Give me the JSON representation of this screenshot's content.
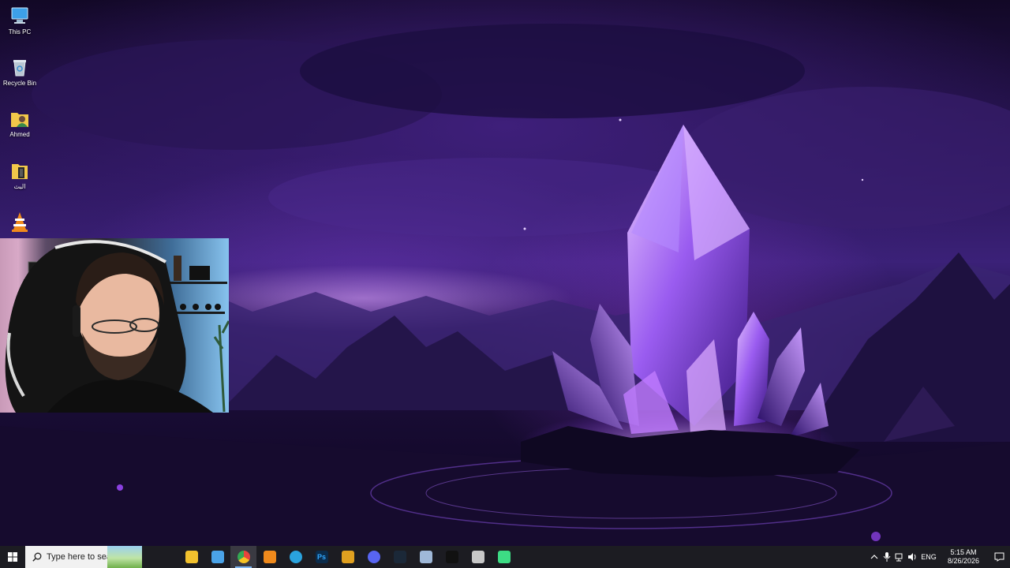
{
  "desktop": {
    "icons": [
      {
        "label": "This PC",
        "icon": "computer-icon"
      },
      {
        "label": "Recycle Bin",
        "icon": "recycle-bin-icon"
      },
      {
        "label": "Ahmed",
        "icon": "user-folder-icon"
      },
      {
        "label": "البث",
        "icon": "folder-icon"
      },
      {
        "label": "",
        "icon": "vlc-icon"
      }
    ]
  },
  "taskbar": {
    "search_placeholder": "Type here to search",
    "apps": [
      {
        "name": "file-explorer",
        "icon": "folder-icon",
        "color": "#f2c12e",
        "active": false
      },
      {
        "name": "store",
        "icon": "window-icon",
        "color": "#4aa3e8",
        "active": false
      },
      {
        "name": "chrome",
        "icon": "chrome-icon",
        "color": "#e8453c",
        "active": true
      },
      {
        "name": "vlc",
        "icon": "vlc-icon",
        "color": "#f08a1c",
        "active": false
      },
      {
        "name": "telegram",
        "icon": "telegram-icon",
        "color": "#2aa3de",
        "active": false
      },
      {
        "name": "photoshop",
        "icon": "photoshop-icon",
        "color": "#0b2b4a",
        "active": false,
        "glyph": "Ps"
      },
      {
        "name": "shield-app",
        "icon": "shield-icon",
        "color": "#e0a020",
        "active": false
      },
      {
        "name": "discord-app",
        "icon": "discord-icon",
        "color": "#5865f2",
        "active": false
      },
      {
        "name": "steam",
        "icon": "steam-icon",
        "color": "#1b2838",
        "active": false
      },
      {
        "name": "vpn-app",
        "icon": "diamond-icon",
        "color": "#9fb8d8",
        "active": false
      },
      {
        "name": "capcut",
        "icon": "capcut-icon",
        "color": "#111111",
        "active": false
      },
      {
        "name": "drive-app",
        "icon": "drive-icon",
        "color": "#c8c8c8",
        "active": false
      },
      {
        "name": "android-app",
        "icon": "android-icon",
        "color": "#3ddc84",
        "active": false
      }
    ],
    "tray": {
      "language": "ENG",
      "time": "5:15 AM",
      "date": "8/26/2026"
    }
  },
  "colors": {
    "taskbar": "#1c1c22",
    "accent": "#7eb4f0",
    "wallpaper_primary": "#3b2178",
    "crystal": "#a86cff"
  }
}
